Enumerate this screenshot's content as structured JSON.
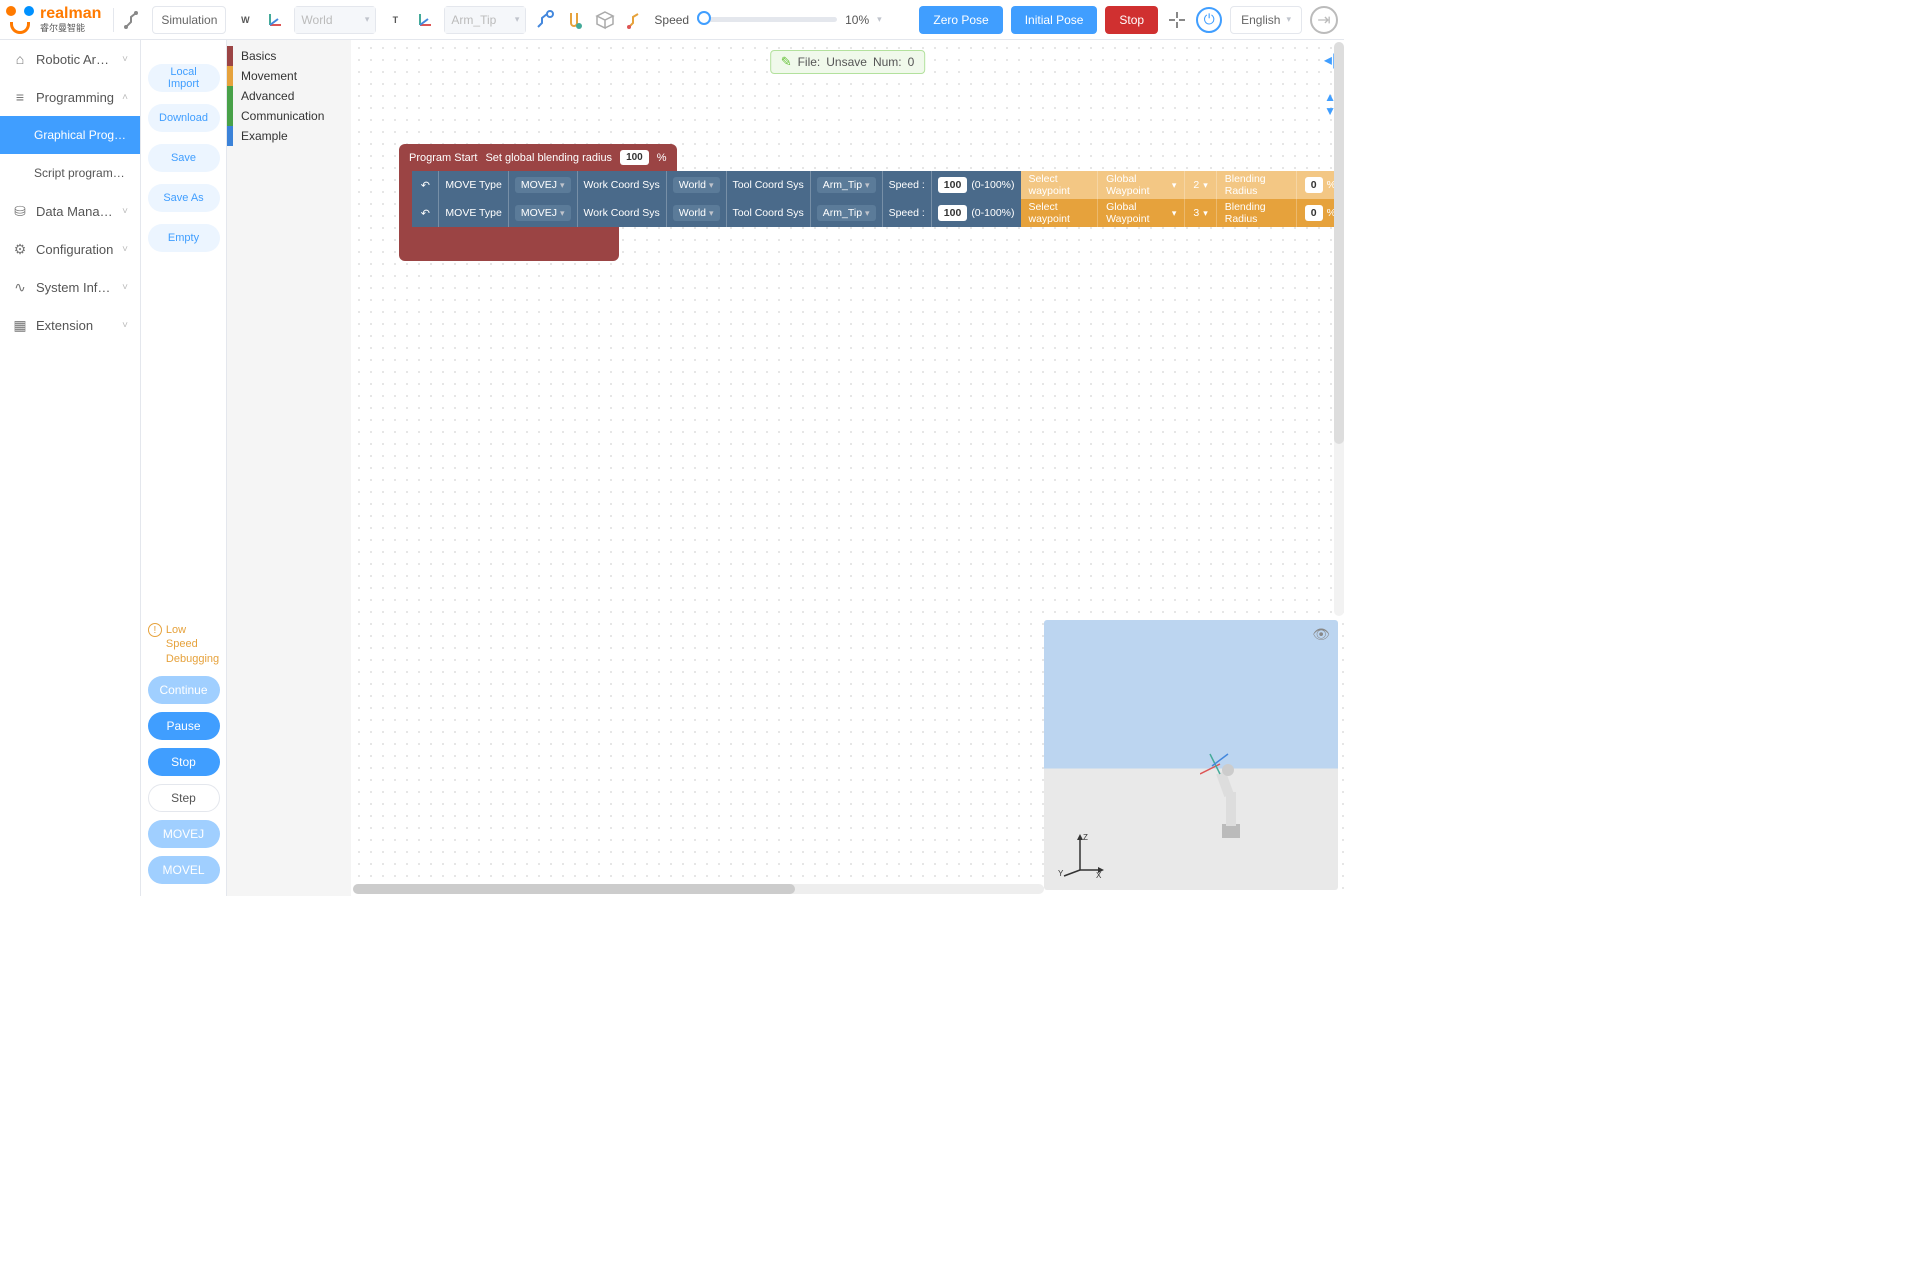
{
  "brand": {
    "name": "realman",
    "sub": "睿尔曼智能"
  },
  "topbar": {
    "mode_label": "Simulation",
    "world_label": "World",
    "tool_label": "Arm_Tip",
    "speed_label": "Speed",
    "speed_value": "10%",
    "zero_pose": "Zero Pose",
    "initial_pose": "Initial Pose",
    "stop": "Stop",
    "language": "English"
  },
  "nav": {
    "items": [
      {
        "label": "Robotic Arm Tea…",
        "icon": "⌂"
      },
      {
        "label": "Programming",
        "icon": "≡",
        "expanded": true
      },
      {
        "label": "Graphical Progr…",
        "child": true,
        "active": true
      },
      {
        "label": "Script programm…",
        "child": true
      },
      {
        "label": "Data Management",
        "icon": "⛁"
      },
      {
        "label": "Configuration",
        "icon": "⚙"
      },
      {
        "label": "System Informat…",
        "icon": "∿"
      },
      {
        "label": "Extension",
        "icon": "▦"
      }
    ]
  },
  "fileops": {
    "buttons": [
      "Local Import",
      "Download",
      "Save",
      "Save As",
      "Empty"
    ],
    "warning": "Low Speed Debugging",
    "run_buttons": [
      {
        "label": "Continue",
        "style": "lightblue"
      },
      {
        "label": "Pause",
        "style": "blue"
      },
      {
        "label": "Stop",
        "style": "blue"
      },
      {
        "label": "Step",
        "style": "white"
      },
      {
        "label": "MOVEJ",
        "style": "lightblue"
      },
      {
        "label": "MOVEL",
        "style": "lightblue"
      }
    ]
  },
  "categories": [
    {
      "label": "Basics",
      "color": "#9b4444"
    },
    {
      "label": "Movement",
      "color": "#e6a23c"
    },
    {
      "label": "Advanced",
      "color": "#48a148"
    },
    {
      "label": "Communication",
      "color": "#48a148"
    },
    {
      "label": "Example",
      "color": "#3b82d8"
    }
  ],
  "file_status": {
    "prefix": "File:",
    "name": "Unsave",
    "num_label": "Num:",
    "num": "0"
  },
  "program": {
    "start_label": "Program Start",
    "blend_label": "Set global blending radius",
    "blend_value": "100",
    "blend_unit": "%",
    "move_rows": [
      {
        "type_label": "MOVE Type",
        "type_val": "MOVEJ",
        "work_label": "Work Coord Sys",
        "work_val": "World",
        "tool_label": "Tool Coord Sys",
        "tool_val": "Arm_Tip",
        "speed_label": "Speed :",
        "speed_val": "100",
        "speed_hint": "(0-100%)",
        "wp_prompt": "Select waypoint",
        "wp_type": "Global Waypoint",
        "wp_idx": "2",
        "br_label": "Blending Radius",
        "br_val": "0",
        "br_unit": "%",
        "faded": true
      },
      {
        "type_label": "MOVE Type",
        "type_val": "MOVEJ",
        "work_label": "Work Coord Sys",
        "work_val": "World",
        "tool_label": "Tool Coord Sys",
        "tool_val": "Arm_Tip",
        "speed_label": "Speed :",
        "speed_val": "100",
        "speed_hint": "(0-100%)",
        "wp_prompt": "Select waypoint",
        "wp_type": "Global Waypoint",
        "wp_idx": "3",
        "br_label": "Blending Radius",
        "br_val": "0",
        "br_unit": "%",
        "faded": false
      }
    ]
  },
  "axis": {
    "x": "X",
    "y": "Y",
    "z": "Z"
  }
}
